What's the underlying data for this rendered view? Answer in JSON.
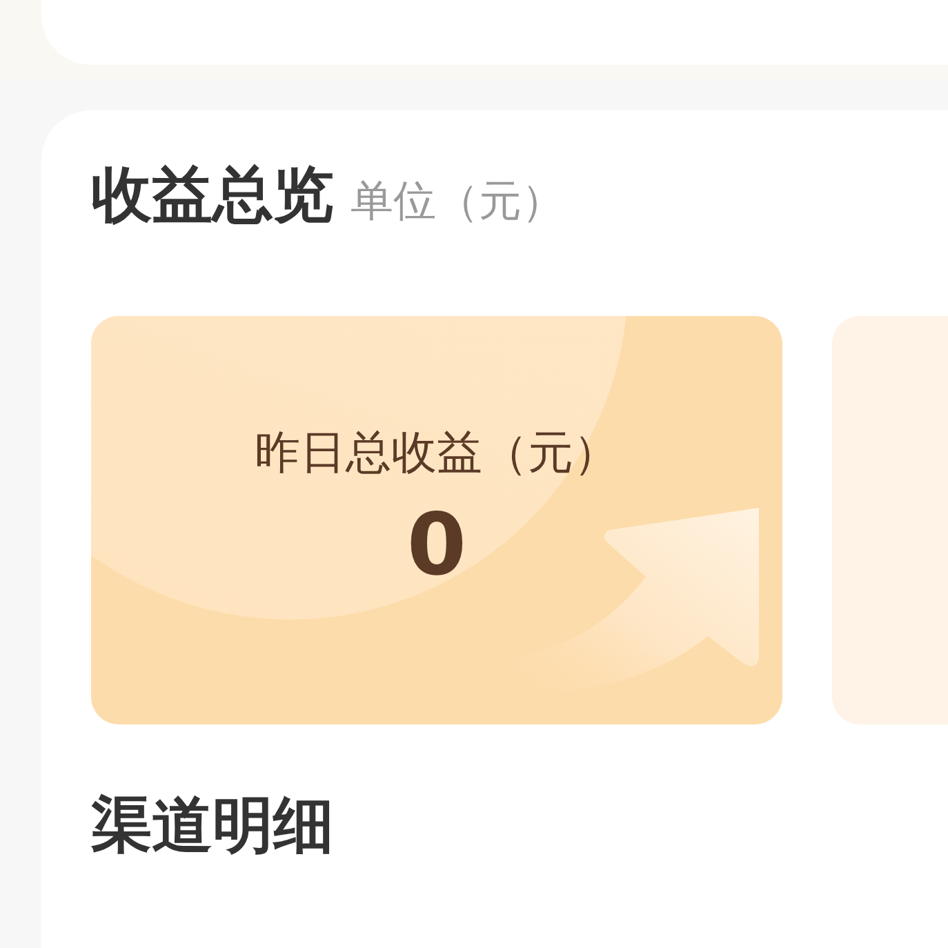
{
  "overview": {
    "title": "收益总览",
    "unit": "单位（元）",
    "cards": [
      {
        "label": "昨日总收益（元）",
        "value": "0"
      }
    ]
  },
  "channel_section": {
    "title": "渠道明细"
  }
}
